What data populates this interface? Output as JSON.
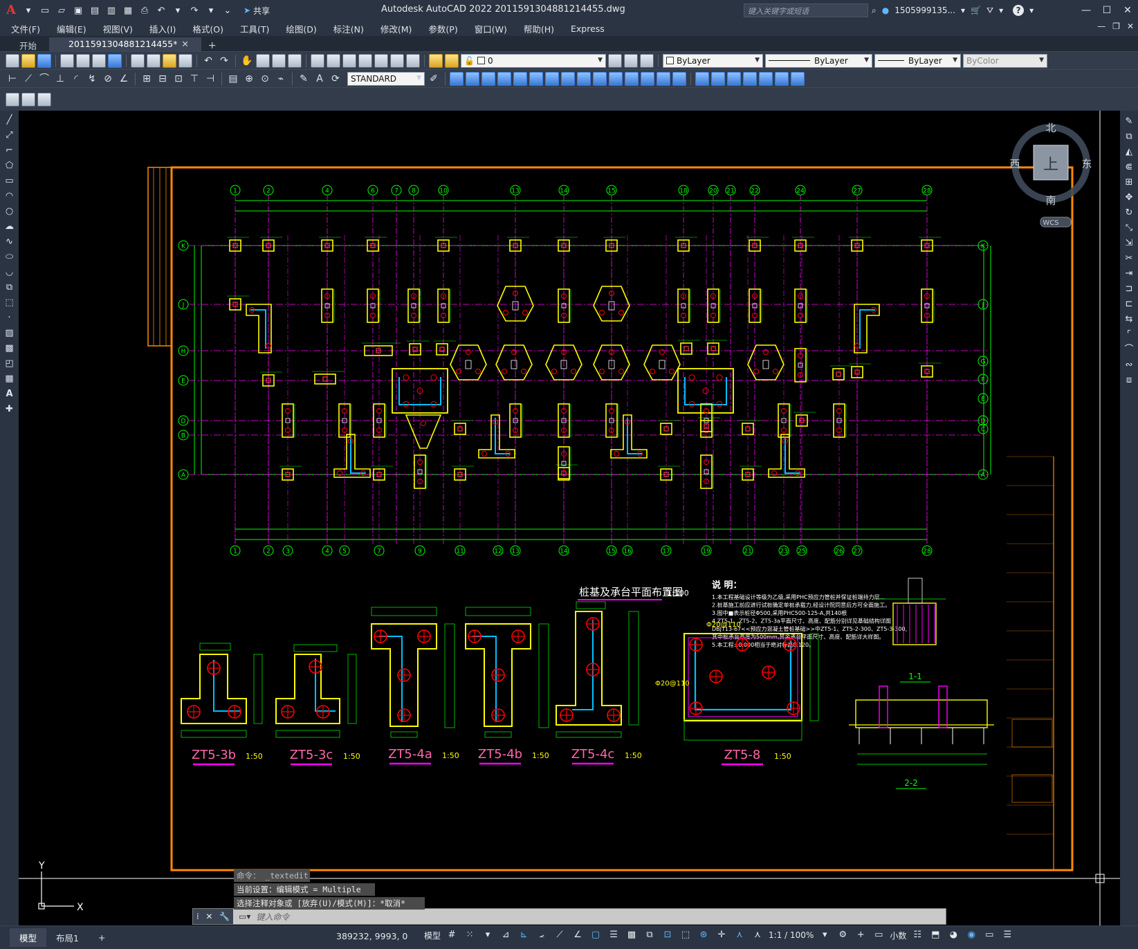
{
  "app": {
    "logo": "A",
    "title": "Autodesk AutoCAD 2022    2011591304881214455.dwg",
    "share_label": "共享",
    "search_placeholder": "键入关键字或短语",
    "user": "1505999135...",
    "help": "?"
  },
  "menu": [
    "文件(F)",
    "编辑(E)",
    "视图(V)",
    "插入(I)",
    "格式(O)",
    "工具(T)",
    "绘图(D)",
    "标注(N)",
    "修改(M)",
    "参数(P)",
    "窗口(W)",
    "帮助(H)",
    "Express"
  ],
  "tabs": [
    {
      "label": "开始",
      "active": false
    },
    {
      "label": "2011591304881214455*",
      "active": true
    }
  ],
  "toolbar": {
    "layer_value": "0",
    "color_value": "ByLayer",
    "linetype_value": "ByLayer",
    "lineweight_value": "ByLayer",
    "plotstyle_value": "ByColor",
    "dimstyle_value": "STANDARD"
  },
  "viewcube": {
    "north": "北",
    "south": "南",
    "east": "东",
    "west": "西",
    "top": "上",
    "wcs": "WCS"
  },
  "drawing": {
    "main_title": "桩基及承台平面布置图",
    "main_scale": "1:100",
    "notes_heading": "说 明：",
    "notes": [
      "1.本工程基础设计等级为乙级,采用PHC预应力管桩并保证桩端持力层...",
      "2.桩基施工前应进行试桩确定单桩承载力,经设计院同意后方可全面施工。",
      "3.图中■表示桩径Φ500,采用PHC500-125-A,共140根",
      "4.ZT5-1、ZT5-2、ZT5-3a平面尺寸、高度、配筋分别详见基础结构详图",
      "  DBJT13-67<<预应力混凝土管桩基础>>中ZT5-1、ZT5-2-300、ZT5-3-300,",
      "  其中桩承台高度为500mm,其余承台平面尺寸、高度、配筋详大样图。",
      "5.本工程±0.000相当于绝对标高8.120。"
    ],
    "axis_top": [
      "1",
      "2",
      "4",
      "6",
      "7",
      "8",
      "10",
      "13",
      "14",
      "15",
      "18",
      "20",
      "21",
      "22",
      "24",
      "27",
      "28"
    ],
    "axis_bottom": [
      "1",
      "2",
      "3",
      "4",
      "5",
      "7",
      "9",
      "11",
      "12",
      "13",
      "14",
      "15",
      "16",
      "17",
      "19",
      "21",
      "23",
      "25",
      "26",
      "27",
      "28"
    ],
    "axis_left": [
      "K",
      "J",
      "H",
      "E",
      "D",
      "B",
      "A"
    ],
    "axis_right": [
      "K",
      "J",
      "G",
      "F",
      "E",
      "D",
      "C",
      "A"
    ],
    "details": [
      {
        "name": "ZT5-3b",
        "scale": "1:50"
      },
      {
        "name": "ZT5-3c",
        "scale": "1:50"
      },
      {
        "name": "ZT5-4a",
        "scale": "1:50"
      },
      {
        "name": "ZT5-4b",
        "scale": "1:50"
      },
      {
        "name": "ZT5-4c",
        "scale": "1:50"
      },
      {
        "name": "ZT5-8",
        "scale": "1:50"
      }
    ],
    "section_11": "1-1",
    "section_22": "2-2",
    "rebar_top": "Φ20@110",
    "rebar_left": "Φ20@110"
  },
  "command": {
    "history": [
      "命令： _textedit",
      "当前设置：编辑模式 = Multiple",
      "选择注释对象或 [放弃(U)/模式(M)]：*取消*"
    ],
    "placeholder": "键入命令"
  },
  "status": {
    "layout_tabs": [
      "模型",
      "布局1"
    ],
    "coords": "389232, 9993, 0",
    "model_label": "模型",
    "annotation_scale": "1:1 / 100%",
    "units": "小数"
  },
  "colors": {
    "green": "#00ff00",
    "yellow": "#ffff00",
    "magenta": "#ff00ff",
    "red": "#ff0000",
    "orange": "#ff8a00",
    "cyan": "#00c0ff"
  }
}
